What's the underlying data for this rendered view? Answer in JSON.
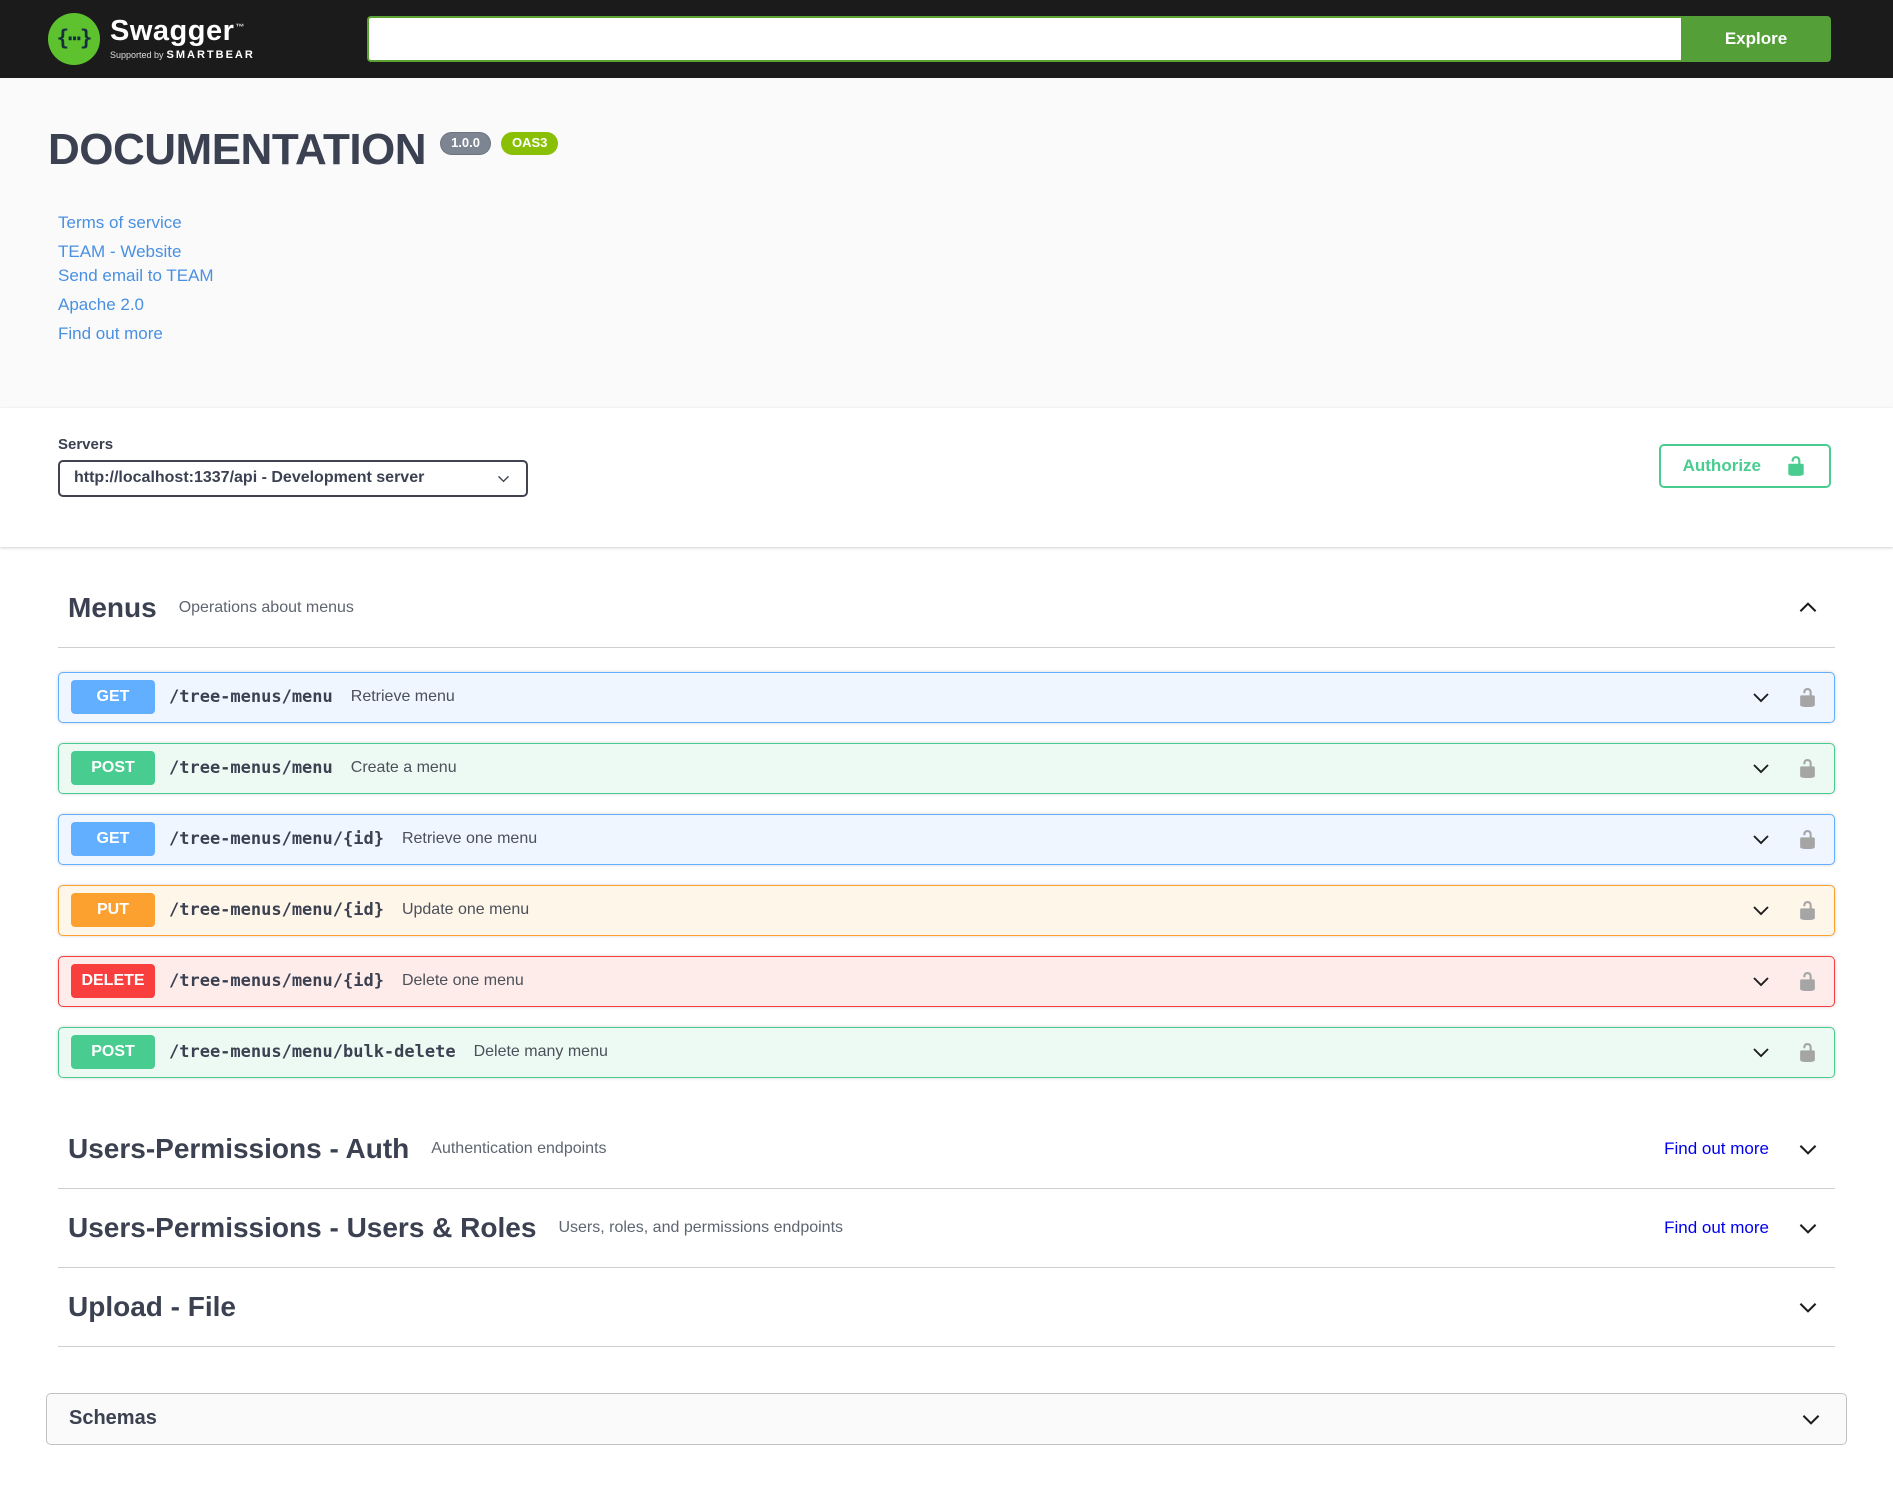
{
  "topbar": {
    "brand": "Swagger",
    "brand_tm": "™",
    "brand_sub_prefix": "Supported by",
    "brand_sub_name": "SMARTBEAR",
    "search": {
      "value": "",
      "placeholder": ""
    },
    "explore_button": "Explore"
  },
  "header": {
    "title": "DOCUMENTATION",
    "version_badge": "1.0.0",
    "oas_badge": "OAS3",
    "links": {
      "terms": "Terms of service",
      "website": "TEAM - Website",
      "email": "Send email to TEAM",
      "license": "Apache 2.0",
      "external_docs": "Find out more"
    }
  },
  "servers": {
    "label": "Servers",
    "selected_option": "http://localhost:1337/api - Development server"
  },
  "authorize": {
    "label": "Authorize"
  },
  "tags": [
    {
      "name": "Menus",
      "description": "Operations about menus",
      "expanded": true,
      "operations": [
        {
          "method": "GET",
          "path": "/tree-menus/menu",
          "summary": "Retrieve menu"
        },
        {
          "method": "POST",
          "path": "/tree-menus/menu",
          "summary": "Create a menu"
        },
        {
          "method": "GET",
          "path": "/tree-menus/menu/{id}",
          "summary": "Retrieve one menu"
        },
        {
          "method": "PUT",
          "path": "/tree-menus/menu/{id}",
          "summary": "Update one menu"
        },
        {
          "method": "DELETE",
          "path": "/tree-menus/menu/{id}",
          "summary": "Delete one menu"
        },
        {
          "method": "POST",
          "path": "/tree-menus/menu/bulk-delete",
          "summary": "Delete many menu"
        }
      ]
    },
    {
      "name": "Users-Permissions - Auth",
      "description": "Authentication endpoints",
      "external_link": "Find out more",
      "expanded": false
    },
    {
      "name": "Users-Permissions - Users & Roles",
      "description": "Users, roles, and permissions endpoints",
      "external_link": "Find out more",
      "expanded": false
    },
    {
      "name": "Upload - File",
      "description": "",
      "expanded": false
    }
  ],
  "schemas": {
    "title": "Schemas"
  },
  "colors": {
    "topbar_background": "#1b1b1b",
    "logo_green": "#5dc22e",
    "explore_green": "#549f38",
    "heading_text": "#3b4151",
    "info_link_blue": "#4990e2",
    "find_out_more_blue": "#0000ee",
    "authorize_green": "#49cc90",
    "version_badge_gray": "#7d8492",
    "oas_badge_green": "#89bf04",
    "method_get": "#61affe",
    "method_post": "#49cc90",
    "method_put": "#fca130",
    "method_delete": "#f93e3e",
    "hero_background": "#fafafa"
  }
}
